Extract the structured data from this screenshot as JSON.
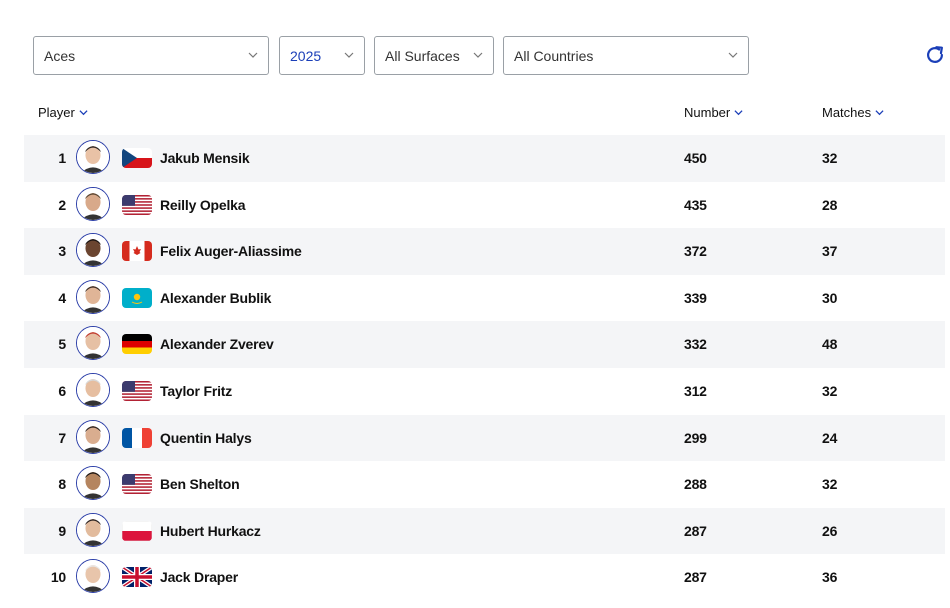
{
  "filters": {
    "stat": "Aces",
    "year": "2025",
    "surface": "All Surfaces",
    "country": "All Countries"
  },
  "table": {
    "headers": {
      "player": "Player",
      "number": "Number",
      "matches": "Matches"
    },
    "rows": [
      {
        "rank": "1",
        "name": "Jakub Mensik",
        "flag": "CZE",
        "number": "450",
        "matches": "32"
      },
      {
        "rank": "2",
        "name": "Reilly Opelka",
        "flag": "USA",
        "number": "435",
        "matches": "28"
      },
      {
        "rank": "3",
        "name": "Felix Auger-Aliassime",
        "flag": "CAN",
        "number": "372",
        "matches": "37"
      },
      {
        "rank": "4",
        "name": "Alexander Bublik",
        "flag": "KAZ",
        "number": "339",
        "matches": "30"
      },
      {
        "rank": "5",
        "name": "Alexander Zverev",
        "flag": "GER",
        "number": "332",
        "matches": "48"
      },
      {
        "rank": "6",
        "name": "Taylor Fritz",
        "flag": "USA",
        "number": "312",
        "matches": "32"
      },
      {
        "rank": "7",
        "name": "Quentin Halys",
        "flag": "FRA",
        "number": "299",
        "matches": "24"
      },
      {
        "rank": "8",
        "name": "Ben Shelton",
        "flag": "USA",
        "number": "288",
        "matches": "32"
      },
      {
        "rank": "9",
        "name": "Hubert Hurkacz",
        "flag": "POL",
        "number": "287",
        "matches": "26"
      },
      {
        "rank": "10",
        "name": "Jack Draper",
        "flag": "GBR",
        "number": "287",
        "matches": "36"
      }
    ]
  },
  "icons": {
    "refresh": "refresh-icon",
    "chevron": "chevron-down-icon"
  },
  "colors": {
    "accent": "#1b3fb8",
    "row_alt": "#f4f5f7",
    "avatar_border": "#2b3ea8"
  }
}
